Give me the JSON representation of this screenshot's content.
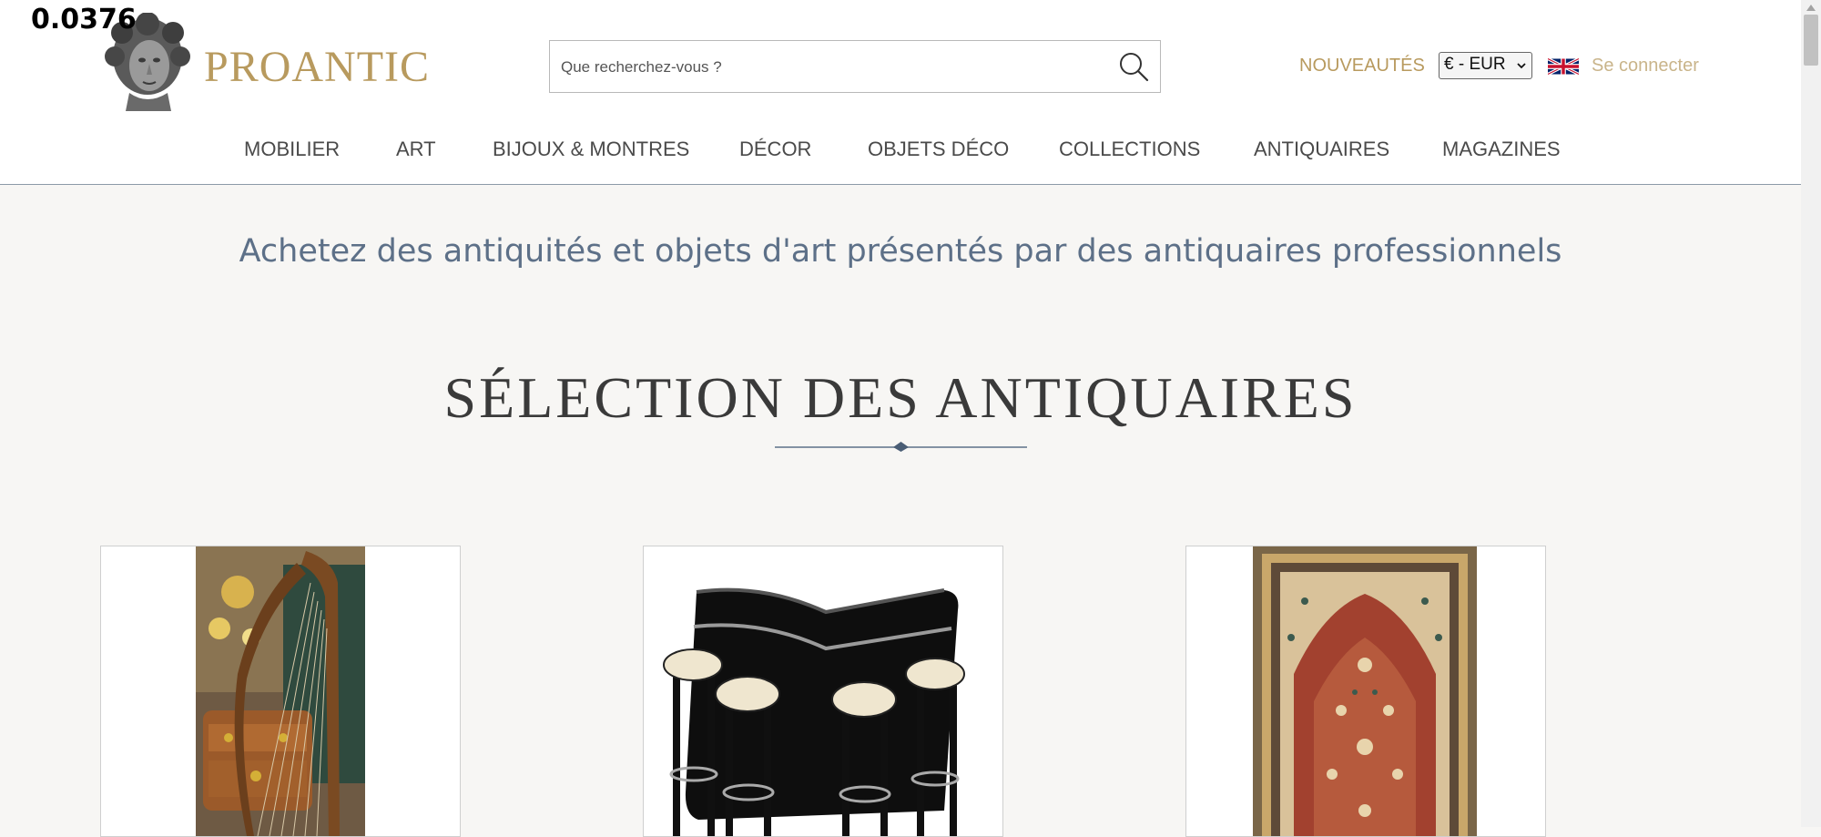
{
  "overlay": {
    "value": "0.0376"
  },
  "header": {
    "logo_text": "PROANTIC",
    "search": {
      "placeholder": "Que recherchez-vous ?",
      "value": ""
    },
    "new_link": "NOUVEAUTÉS",
    "currency": "€ - EUR",
    "login": "Se connecter",
    "icons": {
      "search": "magnifier-icon",
      "flag": "uk-flag-icon",
      "logo": "greek-bust-logo"
    }
  },
  "nav": {
    "items": [
      {
        "label": "MOBILIER"
      },
      {
        "label": "ART"
      },
      {
        "label": "BIJOUX & MONTRES"
      },
      {
        "label": "DÉCOR"
      },
      {
        "label": "OBJETS DÉCO"
      },
      {
        "label": "COLLECTIONS"
      },
      {
        "label": "ANTIQUAIRES"
      },
      {
        "label": "MAGAZINES"
      }
    ]
  },
  "main": {
    "tagline": "Achetez des antiquités et objets d'art présentés par des antiquaires professionnels",
    "section_title": "SÉLECTION DES ANTIQUAIRES",
    "products": [
      {
        "image": "harp-with-antique-commode"
      },
      {
        "image": "black-art-deco-bar-with-stools"
      },
      {
        "image": "persian-prayer-rug"
      }
    ]
  },
  "colors": {
    "gold": "#b89a5e",
    "login_gold": "#c9b48a",
    "tagline_blue": "#5d7088",
    "page_bg": "#f7f6f4"
  }
}
